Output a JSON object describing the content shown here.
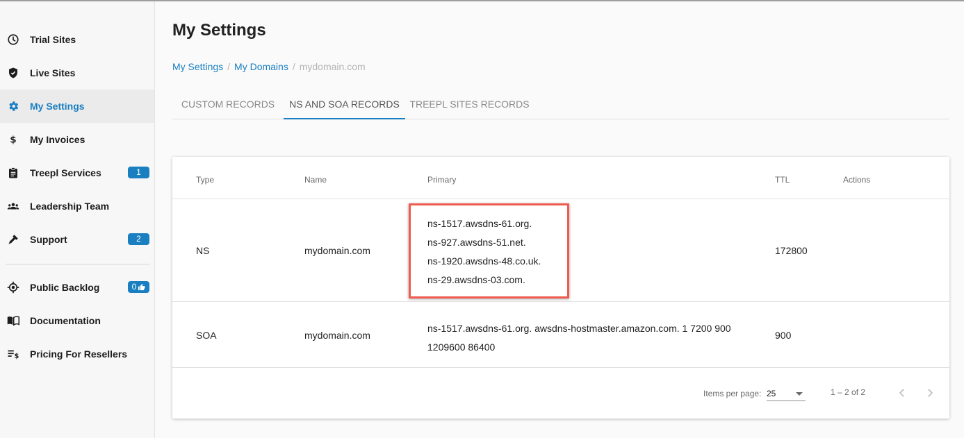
{
  "sidebar": {
    "items": [
      {
        "label": "Trial Sites",
        "icon": "clock-icon"
      },
      {
        "label": "Live Sites",
        "icon": "shield-check-icon"
      },
      {
        "label": "My Settings",
        "icon": "gear-icon",
        "active": true
      },
      {
        "label": "My Invoices",
        "icon": "dollar-icon"
      },
      {
        "label": "Treepl Services",
        "icon": "clipboard-icon",
        "badge": "1"
      },
      {
        "label": "Leadership Team",
        "icon": "people-icon"
      },
      {
        "label": "Support",
        "icon": "wrench-icon",
        "badge": "2"
      },
      {
        "label": "Public Backlog",
        "icon": "target-icon",
        "badge": "0"
      },
      {
        "label": "Documentation",
        "icon": "book-icon"
      },
      {
        "label": "Pricing For Resellers",
        "icon": "price-list-icon"
      }
    ]
  },
  "page": {
    "title": "My Settings"
  },
  "breadcrumb": {
    "items": [
      "My Settings",
      "My Domains"
    ],
    "separator": "/",
    "current": "mydomain.com"
  },
  "tabs": [
    {
      "label": "CUSTOM RECORDS"
    },
    {
      "label": "NS AND SOA RECORDS",
      "active": true
    },
    {
      "label": "TREEPL SITES RECORDS"
    }
  ],
  "table": {
    "headers": {
      "type": "Type",
      "name": "Name",
      "primary": "Primary",
      "ttl": "TTL",
      "actions": "Actions"
    },
    "rows": [
      {
        "type": "NS",
        "name": "mydomain.com",
        "primary": [
          "ns-1517.awsdns-61.org.",
          "ns-927.awsdns-51.net.",
          "ns-1920.awsdns-48.co.uk.",
          "ns-29.awsdns-03.com."
        ],
        "ttl": "172800"
      },
      {
        "type": "SOA",
        "name": "mydomain.com",
        "primary": "ns-1517.awsdns-61.org. awsdns-hostmaster.amazon.com. 1 7200 900 1209600 86400",
        "ttl": "900"
      }
    ]
  },
  "paginator": {
    "items_per_page_label": "Items per page:",
    "page_size": "25",
    "range": "1 – 2 of 2"
  },
  "colors": {
    "accent": "#1a7fc1",
    "highlight": "#ef5b4e"
  }
}
